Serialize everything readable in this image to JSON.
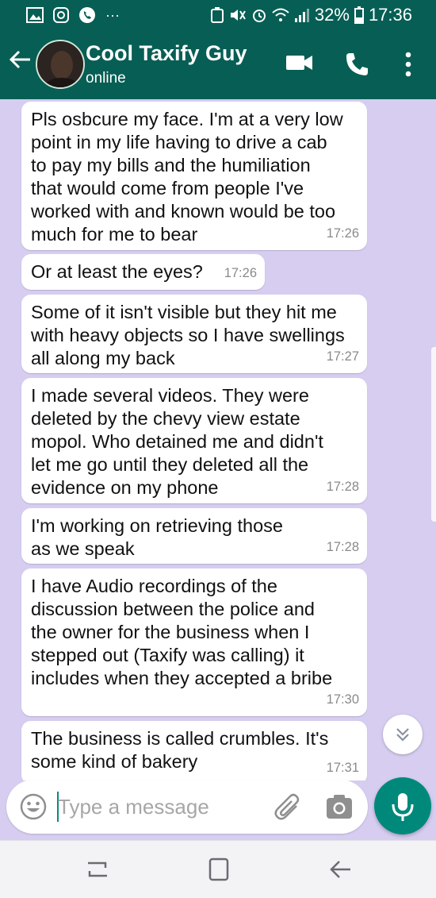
{
  "status_bar": {
    "battery": "32%",
    "time": "17:36",
    "ellipsis": "···"
  },
  "header": {
    "contact_name": "Cool Taxify Guy",
    "status": "online"
  },
  "messages": [
    {
      "text": "Pls osbcure my face. I'm at a very low\npoint in my life having to drive a cab\nto pay my bills and the humiliation\nthat would come from people I've\nworked with and known would be too\nmuch for me to bear",
      "time": "17:26"
    },
    {
      "text": "Or at least the eyes?",
      "time": "17:26"
    },
    {
      "text": "Some of it isn't visible but they hit me\nwith heavy objects so I have swellings\nall along my back",
      "time": "17:27"
    },
    {
      "text": "I made several videos. They were\ndeleted by the chevy view estate\nmopol. Who detained me and didn't\nlet me go until they deleted all the\nevidence on my phone",
      "time": "17:28"
    },
    {
      "text": "I'm working on retrieving those\nas we speak",
      "time": "17:28"
    },
    {
      "text": "I have Audio recordings of the\ndiscussion between the police and\nthe owner for the business when I\nstepped out (Taxify was calling) it\nincludes when they accepted a bribe",
      "time": "17:30"
    },
    {
      "text": "The business is called crumbles. It's\nsome kind of bakery",
      "time": "17:31"
    }
  ],
  "composer": {
    "placeholder": "Type a message"
  },
  "colors": {
    "header": "#075e54",
    "chat_background": "#d6cdf0",
    "accent": "#00897b"
  }
}
